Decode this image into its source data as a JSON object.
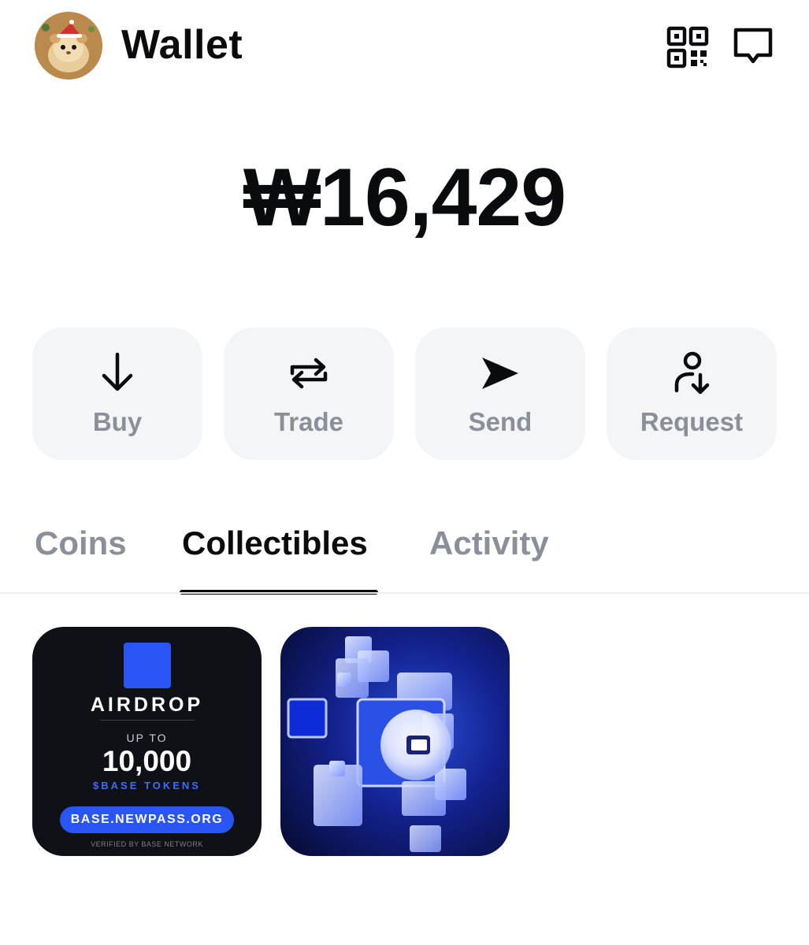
{
  "header": {
    "title": "Wallet",
    "avatar_icon": "hamster-avatar",
    "qr_icon": "qr-code-icon",
    "chat_icon": "chat-bubble-icon"
  },
  "balance": {
    "amount": "₩16,429"
  },
  "actions": [
    {
      "label": "Buy",
      "icon": "arrow-down-icon"
    },
    {
      "label": "Trade",
      "icon": "swap-arrows-icon"
    },
    {
      "label": "Send",
      "icon": "send-arrow-icon"
    },
    {
      "label": "Request",
      "icon": "person-request-icon"
    }
  ],
  "tabs": [
    {
      "label": "Coins",
      "active": false
    },
    {
      "label": "Collectibles",
      "active": true
    },
    {
      "label": "Activity",
      "active": false
    }
  ],
  "collectibles": [
    {
      "type": "airdrop-card",
      "title": "AIRDROP",
      "up_to": "UP TO",
      "amount": "10,000",
      "token": "$BASE TOKENS",
      "button": "BASE.NEWPASS.ORG",
      "verified": "VERIFIED BY BASE NETWORK",
      "accent": "#2955f5"
    },
    {
      "type": "glowing-cubes-image"
    }
  ],
  "colors": {
    "text_primary": "#0a0b0d",
    "text_muted": "#8a8f99",
    "button_bg": "#f4f5f7",
    "brand_blue": "#2955f5"
  }
}
